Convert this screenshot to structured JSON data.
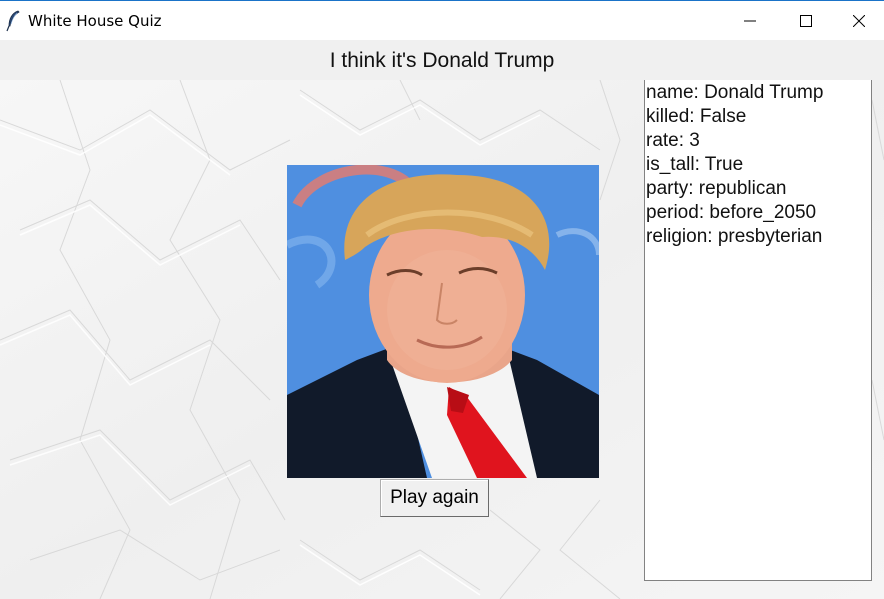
{
  "window": {
    "title": "White House Quiz",
    "controls": {
      "minimize": "minimize",
      "maximize": "maximize",
      "close": "close"
    }
  },
  "header": {
    "text": "I think it's Donald Trump"
  },
  "photo": {
    "subject": "portrait-photo"
  },
  "actions": {
    "play_again_label": "Play again"
  },
  "info": {
    "lines": [
      "name: Donald Trump",
      "killed: False",
      "rate: 3",
      "is_tall: True",
      "party: republican",
      "period: before_2050",
      "religion: presbyterian"
    ]
  },
  "colors": {
    "titlebar_accent": "#1a73c8",
    "background": "#f4f4f4",
    "photo_bg": "#4f8fe0",
    "tie": "#e0141e"
  },
  "icons": {
    "app": "feather-icon"
  }
}
